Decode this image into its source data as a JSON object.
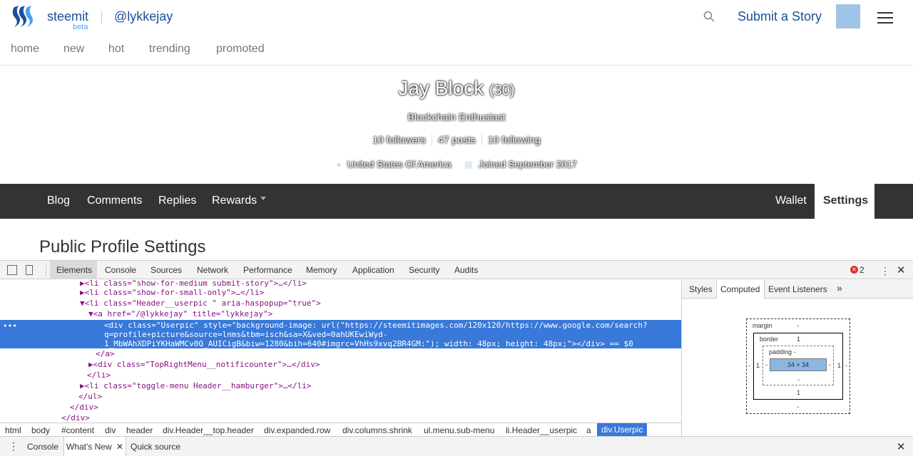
{
  "header": {
    "brand": "steemit",
    "beta": "beta",
    "username": "@lykkejay",
    "submit_label": "Submit a Story"
  },
  "submenu": [
    "home",
    "new",
    "hot",
    "trending",
    "promoted"
  ],
  "profile": {
    "name": "Jay Block",
    "reputation": "(30)",
    "about": "Blockchain Enthusiast",
    "followers": "10 followers",
    "posts": "47 posts",
    "following": "10 following",
    "location": "United States Of America",
    "joined": "Joined September 2017"
  },
  "usermenu": {
    "blog": "Blog",
    "comments": "Comments",
    "replies": "Replies",
    "rewards": "Rewards",
    "wallet": "Wallet",
    "settings": "Settings"
  },
  "section_title": "Public Profile Settings",
  "devtools": {
    "tabs": [
      "Elements",
      "Console",
      "Sources",
      "Network",
      "Performance",
      "Memory",
      "Application",
      "Security",
      "Audits"
    ],
    "error_count": "2",
    "lines": [
      "▶<li class=\"show-for-medium submit-story\">…</li>",
      "▶<li class=\"show-for-small-only\">…</li>",
      "▼<li class=\"Header__userpic \" aria-haspopup=\"true\">",
      "▼<a href=\"/@lykkejay\" title=\"lykkejay\">"
    ],
    "selected_lines": [
      "<div class=\"Userpic\" style=\"background-image: url(\"https://steemitimages.com/120x120/https://www.google.com/search?",
      "q=profile+picture&source=lnms&tbm=isch&sa=X&ved=0ahUKEwiWyd-",
      "1_MbWAhXDPiYKHaWMCv0Q_AUICigB&biw=1280&bih=640#imgrc=VhHs9xvq2BR4GM:\"); width: 48px; height: 48px;\"></div> == $0"
    ],
    "lines_after": [
      "</a>",
      "▶<div class=\"TopRightMenu__notificounter\">…</div>",
      "</li>",
      "▶<li class=\"toggle-menu Header__hamburger\">…</li>",
      "</ul>",
      "</div>",
      "</div>"
    ],
    "breadcrumbs": [
      "html",
      "body",
      "#content",
      "div",
      "header",
      "div.Header__top.header",
      "div.expanded.row",
      "div.columns.shrink",
      "ul.menu.sub-menu",
      "li.Header__userpic",
      "a",
      "div.Userpic"
    ],
    "side_tabs": [
      "Styles",
      "Computed",
      "Event Listeners",
      "»"
    ],
    "box_model": {
      "margin": "margin",
      "margin_value": "-",
      "border": "border",
      "border_value": "1",
      "padding": "padding -",
      "content": "34 × 34",
      "dash": "-"
    },
    "drawer_tabs": [
      "Console",
      "What's New",
      "Quick source"
    ]
  },
  "colors": {
    "brand": "#1a5099",
    "menu_bg": "#333333",
    "selection": "#3879d9"
  }
}
